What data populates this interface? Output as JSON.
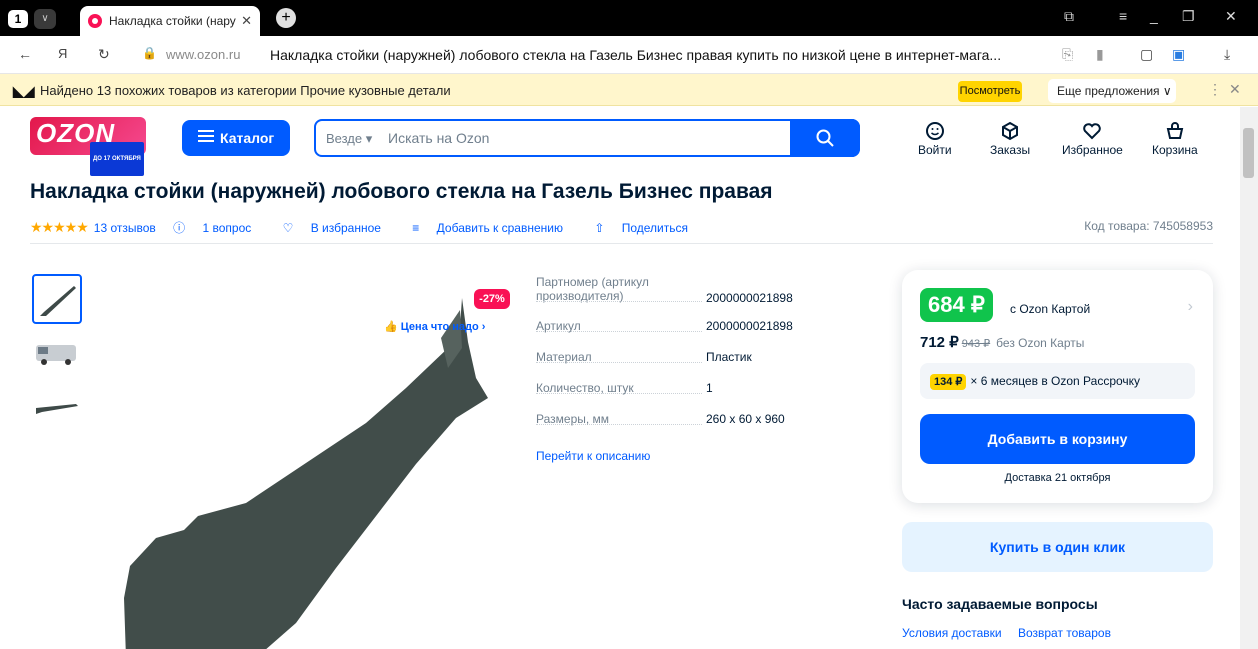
{
  "browser": {
    "tab_count": "1",
    "tab_title": "Накладка стойки (нару",
    "url": "www.ozon.ru",
    "page_title": "Накладка стойки (наружней) лобового стекла на Газель Бизнес правая купить по низкой цене в интернет-мага...",
    "infobar_text": "Найдено 13 похожих товаров из категории Прочие кузовные детали",
    "infobar_button": "Посмотреть",
    "infobar_more": "Еще предложения"
  },
  "header": {
    "logo": "OZON",
    "logo_promo": "ДО 17 ОКТЯБРЯ",
    "catalog_label": "Каталог",
    "search_scope": "Везде",
    "search_placeholder": "Искать на Ozon",
    "nav": [
      {
        "label": "Войти",
        "icon": "user-icon"
      },
      {
        "label": "Заказы",
        "icon": "box-icon"
      },
      {
        "label": "Избранное",
        "icon": "heart-icon"
      },
      {
        "label": "Корзина",
        "icon": "cart-icon"
      }
    ]
  },
  "product": {
    "title": "Накладка стойки (наружней) лобового стекла на Газель Бизнес правая",
    "reviews": "13 отзывов",
    "questions": "1 вопрос",
    "favorite": "В избранное",
    "compare": "Добавить к сравнению",
    "share": "Поделиться",
    "code": "Код товара: 745058953",
    "discount_badge": "-27%",
    "good_price": "Цена что надо",
    "rating": 5,
    "specs": [
      {
        "key": "Партномер (артикул производителя)",
        "value": "2000000021898"
      },
      {
        "key": "Артикул",
        "value": "2000000021898"
      },
      {
        "key": "Материал",
        "value": "Пластик"
      },
      {
        "key": "Количество, штук",
        "value": "1"
      },
      {
        "key": "Размеры, мм",
        "value": "260 x 60 x 960"
      }
    ],
    "description_link": "Перейти к описанию"
  },
  "price": {
    "card_price": "684 ₽",
    "card_note": "с Ozon Картой",
    "regular_price": "712 ₽",
    "old_price": "943 ₽",
    "regular_note": "без Ozon Карты",
    "installment_amount": "134 ₽",
    "installment_text": "× 6 месяцев в Ozon Рассрочку",
    "add_to_cart": "Добавить в корзину",
    "delivery": "Доставка 21 октября",
    "one_click": "Купить в один клик"
  },
  "faq": {
    "title": "Часто задаваемые вопросы",
    "links": [
      "Условия доставки",
      "Возврат товаров"
    ]
  },
  "colors": {
    "brand": "#005bff",
    "accent": "#f91155",
    "green": "#10c44c",
    "yellow": "#ffd400"
  }
}
